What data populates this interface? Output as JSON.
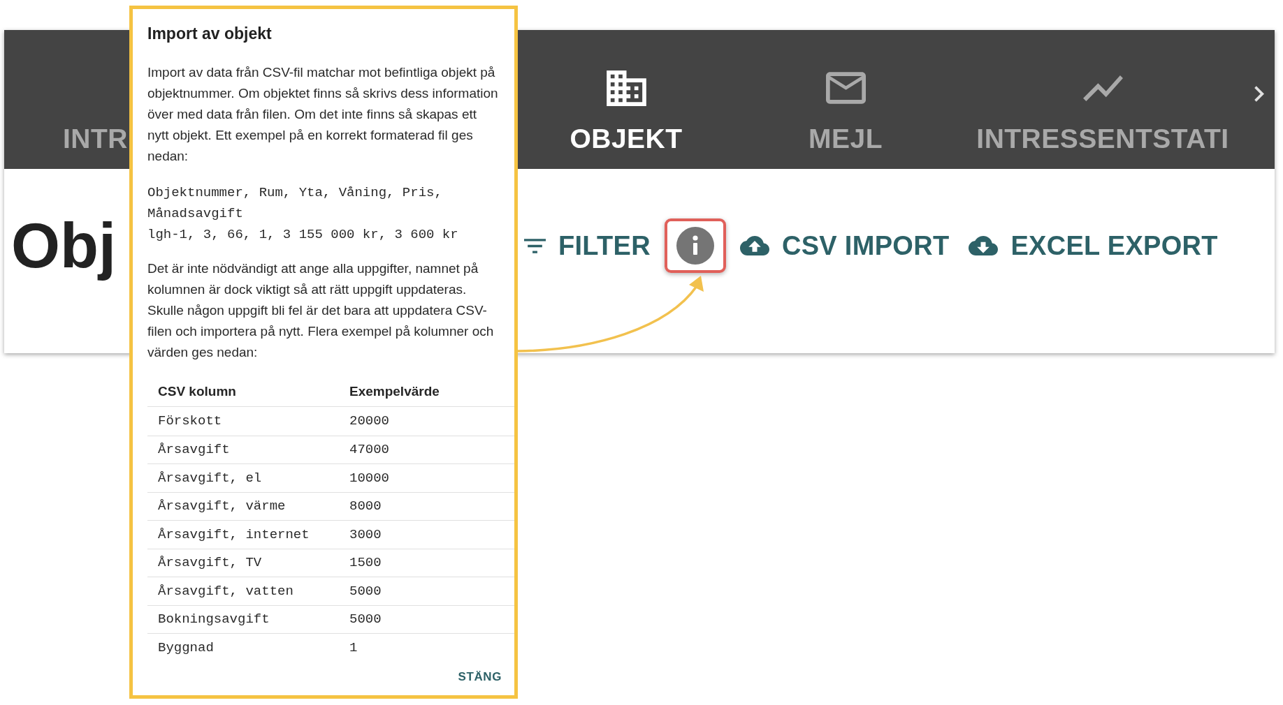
{
  "nav_tabs": [
    {
      "label": "INTR",
      "selected": false
    },
    {
      "label": "OBJEKT",
      "selected": true
    },
    {
      "label": "MEJL",
      "selected": false
    },
    {
      "label": "INTRESSENTSTATI",
      "selected": false
    }
  ],
  "page_title": "Obj",
  "toolbar": [
    {
      "kind": "filter",
      "label": "FILTER",
      "highlighted": false
    },
    {
      "kind": "info",
      "highlighted": true
    },
    {
      "kind": "upload",
      "label": "CSV IMPORT",
      "highlighted": false
    },
    {
      "kind": "download",
      "label": "EXCEL EXPORT",
      "highlighted": false
    }
  ],
  "dialog": {
    "title": "Import av objekt",
    "intro": "Import av data från CSV-fil matchar mot befintliga objekt på objektnummer. Om objektet finns så skrivs dess information över med data från filen. Om det inte finns så skapas ett nytt objekt. Ett exempel på en korrekt formaterad fil ges nedan:",
    "code_lines": [
      "Objektnummer, Rum, Yta, Våning, Pris, Månadsavgift",
      "lgh-1, 3, 66, 1, 3 155 000 kr, 3 600 kr"
    ],
    "note": "Det är inte nödvändigt att ange alla uppgifter, namnet på kolumnen är dock viktigt så att rätt uppgift uppdateras. Skulle någon uppgift bli fel är det bara att uppdatera CSV-filen och importera på nytt. Flera exempel på kolumner och värden ges nedan:",
    "table": {
      "columns": [
        "CSV kolumn",
        "Exempelvärde"
      ],
      "rows": [
        [
          "Förskott",
          "20000"
        ],
        [
          "Årsavgift",
          "47000"
        ],
        [
          "Årsavgift, el",
          "10000"
        ],
        [
          "Årsavgift, värme",
          "8000"
        ],
        [
          "Årsavgift, internet",
          "3000"
        ],
        [
          "Årsavgift, TV",
          "1500"
        ],
        [
          "Årsavgift, vatten",
          "5000"
        ],
        [
          "Bokningsavgift",
          "5000"
        ],
        [
          "Byggnad",
          "1"
        ]
      ]
    },
    "close_button": "STÄNG"
  }
}
